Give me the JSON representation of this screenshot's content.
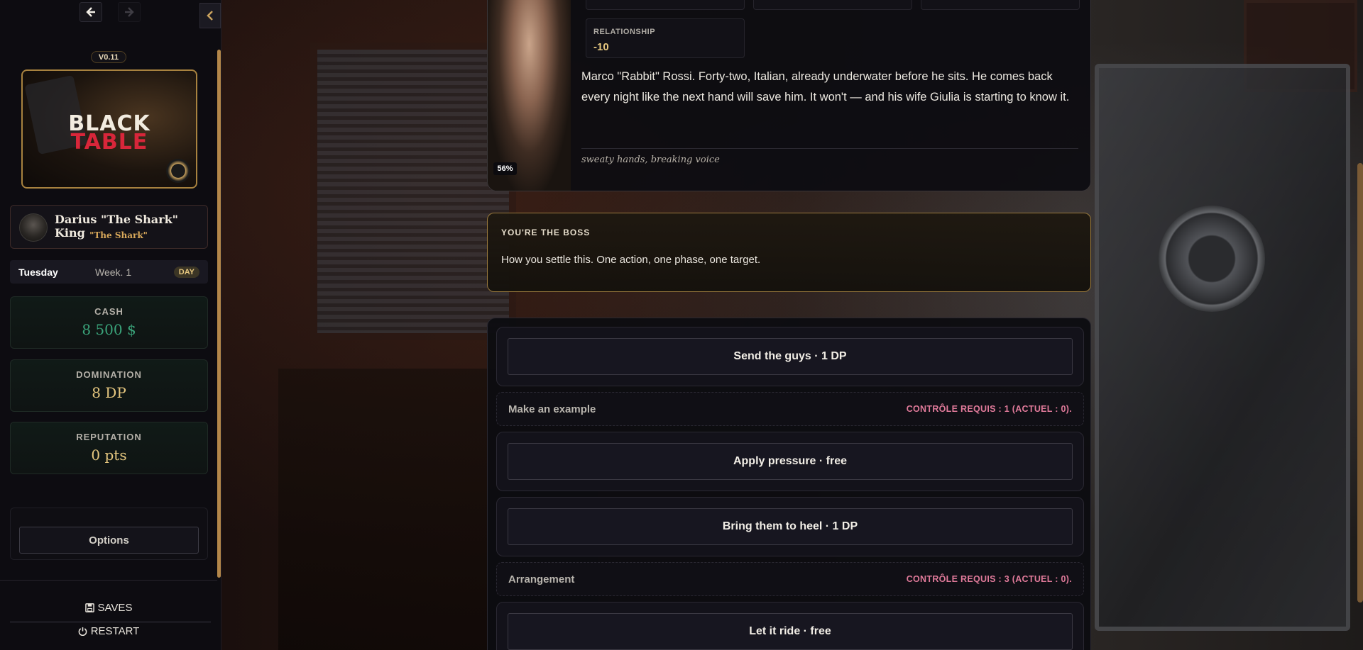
{
  "sidebar": {
    "version": "V0.11",
    "logo": {
      "line1": "BLACK",
      "line2": "TABLE"
    },
    "player": {
      "name": "Darius \"The Shark\" King",
      "nickname": "\"The Shark\""
    },
    "calendar": {
      "day": "Tuesday",
      "week": "Week. 1",
      "phase": "DAY"
    },
    "stats": [
      {
        "label": "CASH",
        "value": "8 500 $",
        "color": "#3aa37a"
      },
      {
        "label": "DOMINATION",
        "value": "8 DP",
        "color": "#e6c77f"
      },
      {
        "label": "REPUTATION",
        "value": "0 pts",
        "color": "#e6c77f"
      }
    ],
    "options_label": "Options",
    "saves_label": "SAVES",
    "restart_label": "RESTART"
  },
  "npc": {
    "portrait_pct": "56%",
    "relationship_label": "RELATIONSHIP",
    "relationship_value": "-10",
    "bio": "Marco \"Rabbit\" Rossi. Forty-two, Italian, already underwater before he sits. He comes back every night like the next hand will save him. It won't — and his wife Giulia is starting to know it.",
    "traits": "sweaty hands, breaking voice"
  },
  "boss": {
    "title": "YOU'RE THE BOSS",
    "description": "How you settle this. One action, one phase, one target."
  },
  "actions": {
    "send_guys": "Send the guys · 1 DP",
    "make_example": {
      "name": "Make an example",
      "requirement": "CONTRÔLE REQUIS : 1 (ACTUEL : 0)."
    },
    "apply_pressure": "Apply pressure · free",
    "bring_to_heel": "Bring them to heel · 1 DP",
    "arrangement": {
      "name": "Arrangement",
      "requirement": "CONTRÔLE REQUIS : 3 (ACTUEL : 0)."
    },
    "let_it_ride": "Let it ride · free"
  },
  "icons": {
    "back": "arrow-left-icon",
    "forward": "arrow-right-icon",
    "collapse": "chevron-left-icon",
    "saves": "floppy-disk-icon",
    "restart": "power-icon"
  },
  "colors": {
    "accent_gold": "#c9a25e",
    "requirement_pink": "#e07a9a",
    "cash_green": "#3aa37a"
  }
}
